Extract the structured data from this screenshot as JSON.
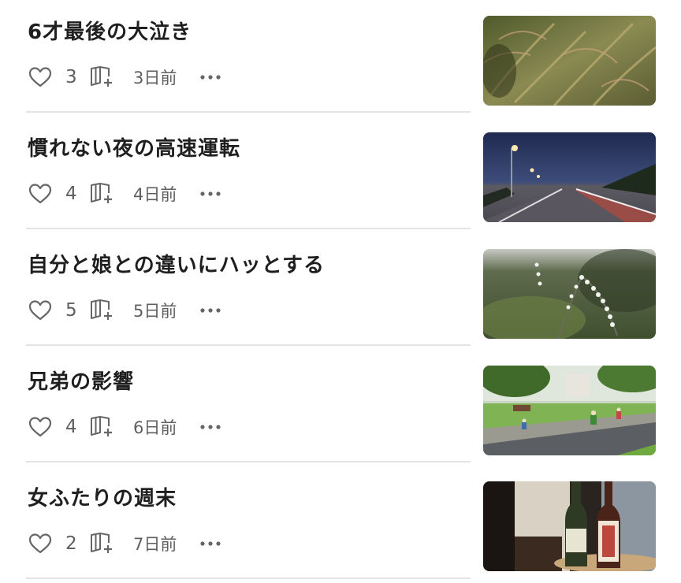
{
  "articles": [
    {
      "title": "6才最後の大泣き",
      "likes": "3",
      "date": "3日前",
      "thumbnail": "fern-leaves-photo"
    },
    {
      "title": "慣れない夜の高速運転",
      "likes": "4",
      "date": "4日前",
      "thumbnail": "night-highway-photo"
    },
    {
      "title": "自分と娘との違いにハッとする",
      "likes": "5",
      "date": "5日前",
      "thumbnail": "white-flower-branch-photo"
    },
    {
      "title": "兄弟の影響",
      "likes": "4",
      "date": "6日前",
      "thumbnail": "park-children-running-photo"
    },
    {
      "title": "女ふたりの週末",
      "likes": "2",
      "date": "7日前",
      "thumbnail": "wine-and-sake-bottles-photo"
    }
  ],
  "icons": {
    "like": "heart-outline-icon",
    "magazine": "magazine-add-icon",
    "more": "more-horizontal-icon"
  },
  "colors": {
    "text": "#1f1f1f",
    "meta": "#5f5f5f",
    "divider": "#e3e3e3"
  }
}
